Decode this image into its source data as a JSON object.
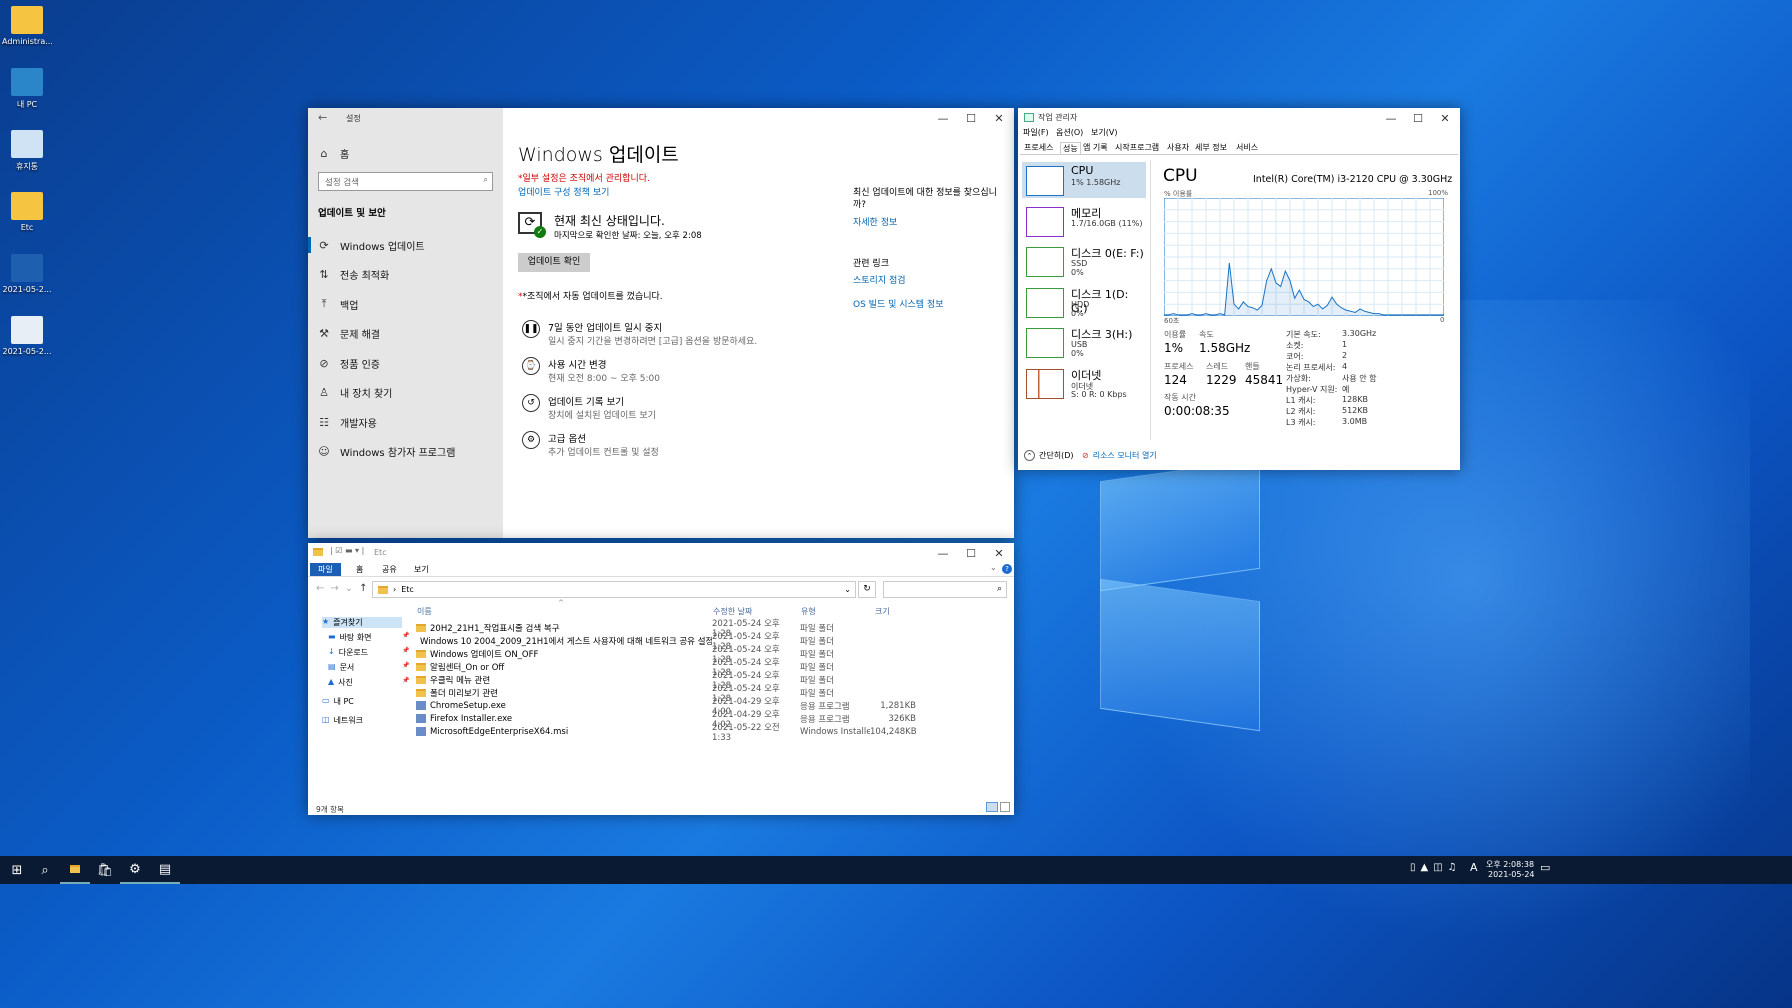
{
  "desktop_icons": [
    {
      "label": "Administra..."
    },
    {
      "label": "내 PC"
    },
    {
      "label": "휴지통"
    },
    {
      "label": "Etc"
    },
    {
      "label": "2021-05-2..."
    },
    {
      "label": "2021-05-2..."
    }
  ],
  "settings": {
    "app_title": "설정",
    "home": "홈",
    "search_placeholder": "설정 검색",
    "section": "업데이트 및 보안",
    "nav": [
      "Windows 업데이트",
      "전송 최적화",
      "백업",
      "문제 해결",
      "정품 인증",
      "내 장치 찾기",
      "개발자용",
      "Windows 참가자 프로그램"
    ],
    "heading": "Windows 업데이트",
    "managed": "*일부 설정은 조직에서 관리합니다.",
    "policy_link": "업데이트 구성 정책 보기",
    "status_title": "현재 최신 상태입니다.",
    "status_sub": "마지막으로 확인한 날짜: 오늘, 오후 2:08",
    "check_button": "업데이트 확인",
    "org_notice": "*조직에서 자동 업데이트를 껐습니다.",
    "options": [
      {
        "title": "7일 동안 업데이트 일시 중지",
        "sub": "일시 중지 기간을 변경하려면 [고급] 옵션을 방문하세요."
      },
      {
        "title": "사용 시간 변경",
        "sub": "현재 오전 8:00 ~ 오후 5:00"
      },
      {
        "title": "업데이트 기록 보기",
        "sub": "장치에 설치된 업데이트 보기"
      },
      {
        "title": "고급 옵션",
        "sub": "추가 업데이트 컨트롤 및 설정"
      }
    ],
    "right_q": "최신 업데이트에 대한 정보를 찾으십니까?",
    "right_more": "자세한 정보",
    "related": "관련 링크",
    "storage_link": "스토리지 점검",
    "os_link": "OS 빌드 및 시스템 정보"
  },
  "taskmgr": {
    "title": "작업 관리자",
    "menu": [
      "파일(F)",
      "옵션(O)",
      "보기(V)"
    ],
    "tabs": [
      "프로세스",
      "성능",
      "앱 기록",
      "시작프로그램",
      "사용자",
      "세부 정보",
      "서비스"
    ],
    "side": [
      {
        "t": "CPU",
        "s1": "1% 1.58GHz",
        "s2": ""
      },
      {
        "t": "메모리",
        "s1": "1.7/16.0GB (11%)",
        "s2": ""
      },
      {
        "t": "디스크 0(E: F:)",
        "s1": "SSD",
        "s2": "0%"
      },
      {
        "t": "디스크 1(D: G:)",
        "s1": "HDD",
        "s2": "0%"
      },
      {
        "t": "디스크 3(H:)",
        "s1": "USB",
        "s2": "0%"
      },
      {
        "t": "이더넷",
        "s1": "이더넷",
        "s2": "S: 0 R: 0 Kbps"
      }
    ],
    "cpu_title": "CPU",
    "cpu_model": "Intel(R) Core(TM) i3-2120 CPU @ 3.30GHz",
    "graph_label": "% 이용률",
    "graph_max": "100%",
    "graph_left": "60초",
    "graph_right": "0",
    "usage_l": "이용률",
    "usage": "1%",
    "speed_l": "속도",
    "speed": "1.58GHz",
    "proc_l": "프로세스",
    "proc": "124",
    "thr_l": "스레드",
    "thr": "1229",
    "hnd_l": "핸들",
    "hnd": "45841",
    "up_l": "작동 시간",
    "up": "0:00:08:35",
    "specs": [
      [
        "기본 속도:",
        "3.30GHz"
      ],
      [
        "소켓:",
        "1"
      ],
      [
        "코어:",
        "2"
      ],
      [
        "논리 프로세서:",
        "4"
      ],
      [
        "가상화:",
        "사용 안 함"
      ],
      [
        "Hyper-V 지원:",
        "예"
      ],
      [
        "L1 캐시:",
        "128KB"
      ],
      [
        "L2 캐시:",
        "512KB"
      ],
      [
        "L3 캐시:",
        "3.0MB"
      ]
    ],
    "fewer": "간단히(D)",
    "resmon": "리소스 모니터 열기",
    "cpu_graph": [
      1,
      1,
      2,
      1,
      1,
      1,
      2,
      1,
      1,
      2,
      1,
      1,
      2,
      1,
      45,
      10,
      6,
      12,
      8,
      7,
      5,
      9,
      30,
      40,
      28,
      25,
      38,
      30,
      15,
      22,
      14,
      12,
      8,
      10,
      6,
      9,
      16,
      10,
      7,
      5,
      4,
      3,
      6,
      4,
      3,
      2,
      2,
      1,
      1,
      1,
      1,
      1,
      1,
      1,
      1,
      1,
      1,
      1,
      1,
      1,
      1
    ]
  },
  "explorer": {
    "path_title": "Etc",
    "ribbon": [
      "파일",
      "홈",
      "공유",
      "보기"
    ],
    "address": "Etc",
    "cols": [
      "이름",
      "수정한 날짜",
      "유형",
      "크기"
    ],
    "nav": [
      {
        "l": "즐겨찾기",
        "ic": "★"
      },
      {
        "l": "바탕 화면",
        "ic": "▬"
      },
      {
        "l": "다운로드",
        "ic": "↓"
      },
      {
        "l": "문서",
        "ic": "▤"
      },
      {
        "l": "사진",
        "ic": "▲"
      },
      {
        "l": "내 PC",
        "ic": "▭"
      },
      {
        "l": "네트워크",
        "ic": "◫"
      }
    ],
    "files": [
      {
        "n": "20H2_21H1_작업표시줄 검색 복구",
        "d": "2021-05-24 오후 1:28",
        "t": "파일 폴더",
        "s": "",
        "k": "folder"
      },
      {
        "n": "Windows 10 2004_2009_21H1에서 게스트 사용자에 대해 네트워크 공유 설정방법",
        "d": "2021-05-24 오후 1:28",
        "t": "파일 폴더",
        "s": "",
        "k": "folder"
      },
      {
        "n": "Windows 업데이트 ON_OFF",
        "d": "2021-05-24 오후 1:28",
        "t": "파일 폴더",
        "s": "",
        "k": "folder"
      },
      {
        "n": "알림센터_On or Off",
        "d": "2021-05-24 오후 1:28",
        "t": "파일 폴더",
        "s": "",
        "k": "folder"
      },
      {
        "n": "우클릭 메뉴 관련",
        "d": "2021-05-24 오후 1:28",
        "t": "파일 폴더",
        "s": "",
        "k": "folder"
      },
      {
        "n": "폴더 미리보기 관련",
        "d": "2021-05-24 오후 1:28",
        "t": "파일 폴더",
        "s": "",
        "k": "folder"
      },
      {
        "n": "ChromeSetup.exe",
        "d": "2021-04-29 오후 4:00",
        "t": "응용 프로그램",
        "s": "1,281KB",
        "k": "exe"
      },
      {
        "n": "Firefox Installer.exe",
        "d": "2021-04-29 오후 4:02",
        "t": "응용 프로그램",
        "s": "326KB",
        "k": "exe"
      },
      {
        "n": "MicrosoftEdgeEnterpriseX64.msi",
        "d": "2021-05-22 오전 1:33",
        "t": "Windows Installer...",
        "s": "104,248KB",
        "k": "exe"
      }
    ],
    "status": "9개 항목"
  },
  "taskbar": {
    "time": "오후 2:08:38",
    "date": "2021-05-24",
    "ime": "A"
  }
}
